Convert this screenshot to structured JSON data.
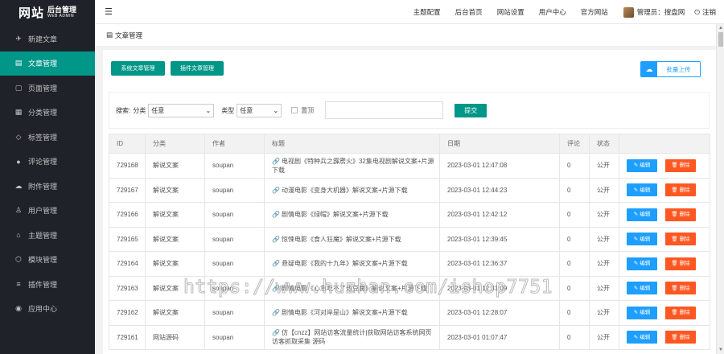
{
  "logo": {
    "main": "网站",
    "top": "后台管理",
    "sub": "WEB ADMIN"
  },
  "sidebar": {
    "items": [
      {
        "icon": "send-icon",
        "glyph": "✈",
        "label": "新建文章",
        "active": false
      },
      {
        "icon": "document-icon",
        "glyph": "▤",
        "label": "文章管理",
        "active": true
      },
      {
        "icon": "page-icon",
        "glyph": "▢",
        "label": "页面管理",
        "active": false
      },
      {
        "icon": "category-icon",
        "glyph": "▦",
        "label": "分类管理",
        "active": false
      },
      {
        "icon": "tag-icon",
        "glyph": "◇",
        "label": "标签管理",
        "active": false
      },
      {
        "icon": "comment-icon",
        "glyph": "●",
        "label": "评论管理",
        "active": false
      },
      {
        "icon": "attachment-icon",
        "glyph": "☁",
        "label": "附件管理",
        "active": false
      },
      {
        "icon": "user-icon",
        "glyph": "♙",
        "label": "用户管理",
        "active": false
      },
      {
        "icon": "theme-icon",
        "glyph": "⌂",
        "label": "主题管理",
        "active": false
      },
      {
        "icon": "module-icon",
        "glyph": "⬡",
        "label": "模块管理",
        "active": false
      },
      {
        "icon": "plugin-icon",
        "glyph": "≡",
        "label": "插件管理",
        "active": false
      },
      {
        "icon": "app-center-icon",
        "glyph": "◉",
        "label": "应用中心",
        "active": false
      }
    ]
  },
  "header": {
    "links": [
      "主题配置",
      "后台首页",
      "网站设置",
      "用户中心",
      "官方网站"
    ],
    "user": "管理员：搜盘网",
    "logout": "注销"
  },
  "breadcrumb": {
    "label": "文章管理"
  },
  "toolbar": {
    "sys_articles": "系统文章管理",
    "plugin_articles": "插件文章管理",
    "upload": "批量上传"
  },
  "filter": {
    "search_label": "搜索:",
    "category_label": "分类",
    "category_value": "任意",
    "type_label": "类型",
    "type_value": "任意",
    "top_label": "置顶",
    "keyword_placeholder": "",
    "submit": "提交"
  },
  "table": {
    "headers": [
      "ID",
      "分类",
      "作者",
      "标题",
      "日期",
      "评论",
      "状态",
      ""
    ],
    "edit_label": "编辑",
    "delete_label": "删除",
    "rows": [
      {
        "id": "729168",
        "category": "解说文案",
        "author": "soupan",
        "title": "电视剧《特种兵之霹雳火》32集电视剧解说文案+片源下载",
        "date": "2023-03-01 12:47:08",
        "comments": "0",
        "status": "公开"
      },
      {
        "id": "729167",
        "category": "解说文案",
        "author": "soupan",
        "title": "动漫电影《变身大机器》解说文案+片源下载",
        "date": "2023-03-01 12:44:23",
        "comments": "0",
        "status": "公开"
      },
      {
        "id": "729166",
        "category": "解说文案",
        "author": "soupan",
        "title": "剧情电影《绿帽》解说文案+片源下载",
        "date": "2023-03-01 12:42:12",
        "comments": "0",
        "status": "公开"
      },
      {
        "id": "729165",
        "category": "解说文案",
        "author": "soupan",
        "title": "惊悚电影《食人狂魔》解说文案+片源下载",
        "date": "2023-03-01 12:39:45",
        "comments": "0",
        "status": "公开"
      },
      {
        "id": "729164",
        "category": "解说文案",
        "author": "soupan",
        "title": "悬疑电影《我的十九年》解说文案+片源下载",
        "date": "2023-03-01 12:36:37",
        "comments": "0",
        "status": "公开"
      },
      {
        "id": "729163",
        "category": "解说文案",
        "author": "soupan",
        "title": "剧情电影《心急吃不了热豆腐》解说文案+片源下载",
        "date": "2023-03-01 12:31:09",
        "comments": "0",
        "status": "公开"
      },
      {
        "id": "729162",
        "category": "解说文案",
        "author": "soupan",
        "title": "剧情电影《河对岸是山》解说文案+片源下载",
        "date": "2023-03-01 12:28:07",
        "comments": "0",
        "status": "公开"
      },
      {
        "id": "729161",
        "category": "网站源码",
        "author": "soupan",
        "title": "仿【cnzz】网站访客流量统计|获取网站访客系统网页访客抓取采集 源码",
        "date": "2023-03-01 01:07:47",
        "comments": "0",
        "status": "公开"
      }
    ]
  },
  "watermark": "https://www.huzhan.com/ishop7751"
}
